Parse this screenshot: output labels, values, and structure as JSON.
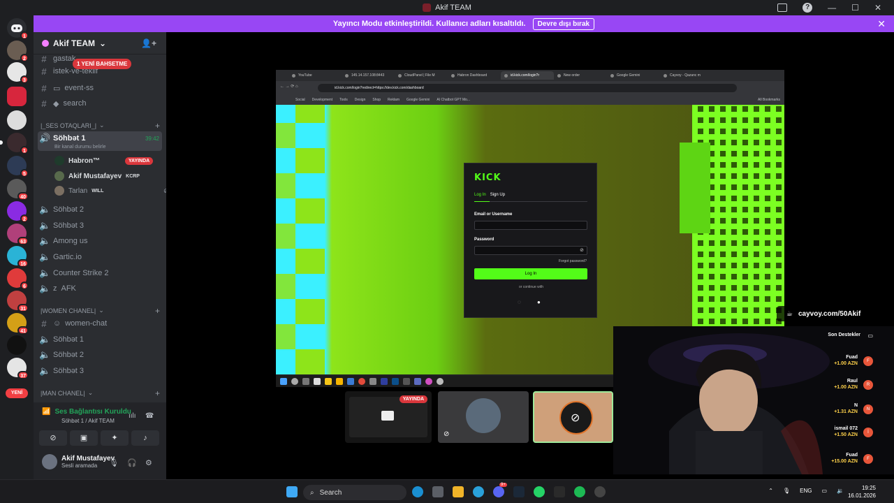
{
  "window": {
    "title": "Akif TEAM"
  },
  "banner": {
    "text": "Yayıncı Modu etkinleştirildi. Kullanıcı adları kısaltıldı.",
    "button": "Devre dışı bırak"
  },
  "rail": {
    "new_label": "YENİ",
    "badges": [
      "1",
      "2",
      "3",
      "1",
      "5",
      "40",
      "2",
      "63",
      "16",
      "6",
      "31",
      "41",
      "37"
    ]
  },
  "server": {
    "name": "Akif TEAM"
  },
  "channels": {
    "mention_badge": "1 YENİ BAHSETME",
    "top": [
      {
        "name": "gastak"
      },
      {
        "name": "istek-ve-teklif"
      },
      {
        "name": "event-ss"
      },
      {
        "name": "search"
      }
    ],
    "voice_category": "|_SES OTAQLARI_|",
    "active_channel": {
      "name": "Söhbət 1",
      "timer": "39:42",
      "status": "Bir kanal durumu belirle"
    },
    "users": [
      {
        "name": "Habron™",
        "tag": "YAYINDA"
      },
      {
        "name": "Akif Mustafayev",
        "tag": "KCRP"
      },
      {
        "name": "Tarlan",
        "tag": "WILL"
      }
    ],
    "voice_rooms": [
      "Söhbət 2",
      "Söhbət 3",
      "Among us",
      "Gartic.io",
      "Counter Strike 2",
      "AFK"
    ],
    "women_category": "|WOMEN CHANEL|",
    "women_channels": [
      "women-chat",
      "Söhbət 1",
      "Söhbət 2",
      "Söhbət 3"
    ],
    "man_category": "|MAN CHANEL|"
  },
  "voice_panel": {
    "status": "Ses Bağlantısı Kuruldu",
    "sub": "Söhbət 1 / Akif TEAM",
    "user_name": "Akif Mustafayev",
    "user_status": "Sesli aramada"
  },
  "browser": {
    "tabs": [
      "YouTube",
      "145.14.157.108:8443",
      "CloudPanel | File M",
      "Habron Dashboard",
      "id.kick.com/login?r",
      "New order",
      "Google Gemini",
      "Cayvoy - Qazanc m"
    ],
    "url": "id.kick.com/login?redirect=https://dev.kick.com/dashboard",
    "bookmarks": [
      "Social",
      "Development",
      "Tools",
      "Design",
      "Shop",
      "Reklam",
      "Google Gemini",
      "AI Chatbot GPT Mo..."
    ],
    "all_bookmarks": "All Bookmarks"
  },
  "kick": {
    "logo": "KICK",
    "tab_login": "Log In",
    "tab_signup": "Sign Up",
    "email_label": "Email or Username",
    "password_label": "Password",
    "forgot": "Forgot password?",
    "login_button": "Log In",
    "continue": "or continue with"
  },
  "tiles": {
    "live": "YAYINDA"
  },
  "overlay": {
    "cayvoy": "cayvoy.com/50Akif",
    "donors_title": "Son Destekler",
    "donors": [
      {
        "name": "Fuad",
        "amount": "+1.00 AZN",
        "initial": "F"
      },
      {
        "name": "Raul",
        "amount": "+1.00 AZN",
        "initial": "R"
      },
      {
        "name": "N",
        "amount": "+1.31 AZN",
        "initial": "N"
      },
      {
        "name": "ismail 072",
        "amount": "+1.50 AZN",
        "initial": "İ"
      },
      {
        "name": "Fuad",
        "amount": "+15.00 AZN",
        "initial": "F"
      }
    ]
  },
  "taskbar": {
    "search": "Search",
    "lang": "ENG",
    "time": "19:25",
    "date": "16.01.2026",
    "discord_badge": "9+"
  }
}
